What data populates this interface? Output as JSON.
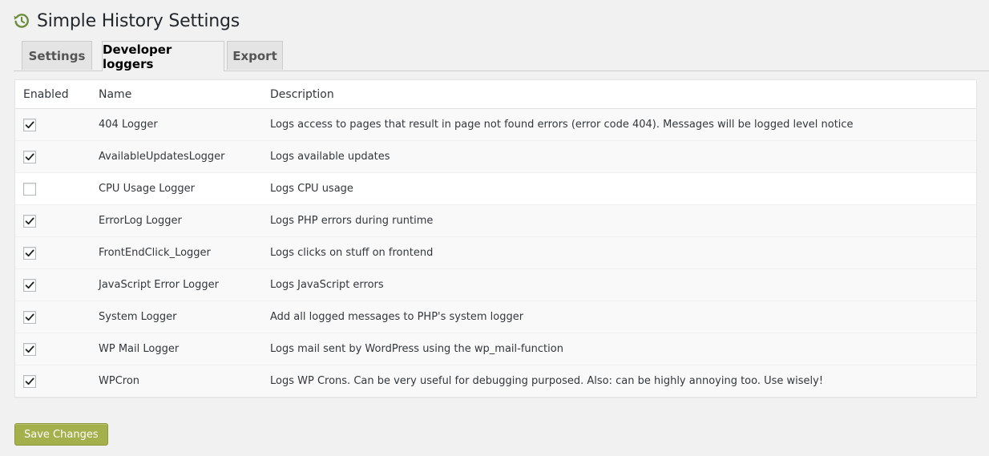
{
  "page": {
    "title": "Simple History Settings",
    "title_icon": "history-icon",
    "accent_color": "#6d8d3b"
  },
  "tabs": [
    {
      "label": "Settings",
      "active": false
    },
    {
      "label": "Developer loggers",
      "active": true
    },
    {
      "label": "Export",
      "active": false
    }
  ],
  "table": {
    "headers": {
      "enabled": "Enabled",
      "name": "Name",
      "description": "Description"
    },
    "rows": [
      {
        "enabled": true,
        "name": "404 Logger",
        "description": "Logs access to pages that result in page not found errors (error code 404). Messages will be logged level notice"
      },
      {
        "enabled": true,
        "name": "AvailableUpdatesLogger",
        "description": "Logs available updates"
      },
      {
        "enabled": false,
        "name": "CPU Usage Logger",
        "description": "Logs CPU usage"
      },
      {
        "enabled": true,
        "name": "ErrorLog Logger",
        "description": "Logs PHP errors during runtime"
      },
      {
        "enabled": true,
        "name": "FrontEndClick_Logger",
        "description": "Logs clicks on stuff on frontend"
      },
      {
        "enabled": true,
        "name": "JavaScript Error Logger",
        "description": "Logs JavaScript errors"
      },
      {
        "enabled": true,
        "name": "System Logger",
        "description": "Add all logged messages to PHP's system logger"
      },
      {
        "enabled": true,
        "name": "WP Mail Logger",
        "description": "Logs mail sent by WordPress using the wp_mail-function"
      },
      {
        "enabled": true,
        "name": "WPCron",
        "description": "Logs WP Crons. Can be very useful for debugging purposed. Also: can be highly annoying too. Use wisely!"
      }
    ]
  },
  "footer": {
    "save_label": "Save Changes",
    "save_color": "#a4b04b"
  }
}
